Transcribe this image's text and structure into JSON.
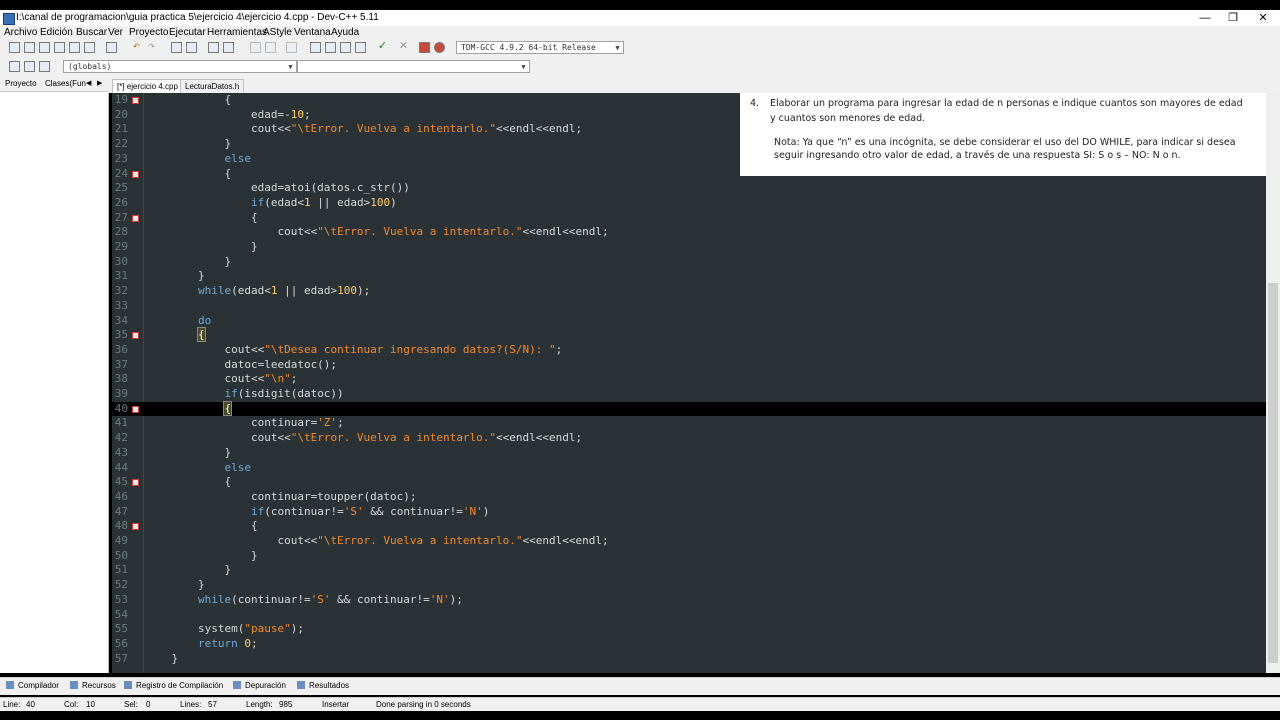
{
  "window": {
    "title": "I:\\canal de programacion\\guia practica 5\\ejercicio 4\\ejercicio 4.cpp - Dev-C++ 5.11"
  },
  "menu": [
    "Archivo",
    "Edición",
    "Buscar",
    "Ver",
    "Proyecto",
    "Ejecutar",
    "Herramientas",
    "AStyle",
    "Ventana",
    "Ayuda"
  ],
  "toolbar": {
    "compiler": "TDM-GCC 4.9.2 64-bit Release",
    "scope": "(globals)",
    "symbol": ""
  },
  "left_panel": {
    "tabs": [
      "Proyecto",
      "Clases(Fun"
    ]
  },
  "editor_tabs": [
    "[*] ejercicio 4.cpp",
    "LecturaDatos.h"
  ],
  "code_lines": [
    {
      "n": "19",
      "fold": true,
      "seg": [
        [
          "p",
          "            {"
        ]
      ]
    },
    {
      "n": "20",
      "seg": [
        [
          "p",
          "                edad=-"
        ],
        [
          "num",
          "10"
        ],
        [
          "p",
          ";"
        ]
      ]
    },
    {
      "n": "21",
      "seg": [
        [
          "p",
          "                cout<<"
        ],
        [
          "str",
          "\"\\tError. Vuelva a intentarlo.\""
        ],
        [
          "p",
          "<<endl<<endl;"
        ]
      ]
    },
    {
      "n": "22",
      "seg": [
        [
          "p",
          "            }"
        ]
      ]
    },
    {
      "n": "23",
      "seg": [
        [
          "kw",
          "            else"
        ]
      ]
    },
    {
      "n": "24",
      "fold": true,
      "seg": [
        [
          "p",
          "            {"
        ]
      ]
    },
    {
      "n": "25",
      "seg": [
        [
          "p",
          "                edad=atoi(datos.c_str())"
        ]
      ]
    },
    {
      "n": "26",
      "seg": [
        [
          "kw",
          "                if"
        ],
        [
          "p",
          "(edad<"
        ],
        [
          "num",
          "1"
        ],
        [
          "p",
          " || edad>"
        ],
        [
          "num",
          "100"
        ],
        [
          "p",
          ")"
        ]
      ]
    },
    {
      "n": "27",
      "fold": true,
      "seg": [
        [
          "p",
          "                {"
        ]
      ]
    },
    {
      "n": "28",
      "seg": [
        [
          "p",
          "                    cout<<"
        ],
        [
          "str",
          "\"\\tError. Vuelva a intentarlo.\""
        ],
        [
          "p",
          "<<endl<<endl;"
        ]
      ]
    },
    {
      "n": "29",
      "seg": [
        [
          "p",
          "                }"
        ]
      ]
    },
    {
      "n": "30",
      "seg": [
        [
          "p",
          "            }"
        ]
      ]
    },
    {
      "n": "31",
      "seg": [
        [
          "p",
          "        }"
        ]
      ]
    },
    {
      "n": "32",
      "seg": [
        [
          "kw",
          "        while"
        ],
        [
          "p",
          "(edad<"
        ],
        [
          "num",
          "1"
        ],
        [
          "p",
          " || edad>"
        ],
        [
          "num",
          "100"
        ],
        [
          "p",
          ");"
        ]
      ]
    },
    {
      "n": "33",
      "seg": [
        [
          "p",
          ""
        ]
      ]
    },
    {
      "n": "34",
      "seg": [
        [
          "kw",
          "        do"
        ]
      ]
    },
    {
      "n": "35",
      "fold": true,
      "seg": [
        [
          "p",
          "        "
        ],
        [
          "brk",
          "{"
        ]
      ]
    },
    {
      "n": "36",
      "seg": [
        [
          "p",
          "            cout<<"
        ],
        [
          "str",
          "\"\\tDesea continuar ingresando datos?(S/N): \""
        ],
        [
          "p",
          ";"
        ]
      ]
    },
    {
      "n": "37",
      "seg": [
        [
          "p",
          "            datoc=leedatoc();"
        ]
      ]
    },
    {
      "n": "38",
      "seg": [
        [
          "p",
          "            cout<<"
        ],
        [
          "str",
          "\"\\n\""
        ],
        [
          "p",
          ";"
        ]
      ]
    },
    {
      "n": "39",
      "seg": [
        [
          "kw",
          "            if"
        ],
        [
          "p",
          "(isdigit(datoc))"
        ]
      ]
    },
    {
      "n": "40",
      "fold": true,
      "hl": true,
      "seg": [
        [
          "p",
          "            "
        ],
        [
          "brk",
          "{"
        ]
      ]
    },
    {
      "n": "41",
      "seg": [
        [
          "p",
          "                continuar="
        ],
        [
          "str",
          "'Z'"
        ],
        [
          "p",
          ";"
        ]
      ]
    },
    {
      "n": "42",
      "seg": [
        [
          "p",
          "                cout<<"
        ],
        [
          "str",
          "\"\\tError. Vuelva a intentarlo.\""
        ],
        [
          "p",
          "<<endl<<endl;"
        ]
      ]
    },
    {
      "n": "43",
      "seg": [
        [
          "p",
          "            }"
        ]
      ]
    },
    {
      "n": "44",
      "seg": [
        [
          "kw",
          "            else"
        ]
      ]
    },
    {
      "n": "45",
      "fold": true,
      "seg": [
        [
          "p",
          "            {"
        ]
      ]
    },
    {
      "n": "46",
      "seg": [
        [
          "p",
          "                continuar=toupper(datoc);"
        ]
      ]
    },
    {
      "n": "47",
      "seg": [
        [
          "kw",
          "                if"
        ],
        [
          "p",
          "(continuar!="
        ],
        [
          "str",
          "'S'"
        ],
        [
          "p",
          " && continuar!="
        ],
        [
          "str",
          "'N'"
        ],
        [
          "p",
          ")"
        ]
      ]
    },
    {
      "n": "48",
      "fold": true,
      "seg": [
        [
          "p",
          "                {"
        ]
      ]
    },
    {
      "n": "49",
      "seg": [
        [
          "p",
          "                    cout<<"
        ],
        [
          "str",
          "\"\\tError. Vuelva a intentarlo.\""
        ],
        [
          "p",
          "<<endl<<endl;"
        ]
      ]
    },
    {
      "n": "50",
      "seg": [
        [
          "p",
          "                }"
        ]
      ]
    },
    {
      "n": "51",
      "seg": [
        [
          "p",
          "            }"
        ]
      ]
    },
    {
      "n": "52",
      "seg": [
        [
          "p",
          "        }"
        ]
      ]
    },
    {
      "n": "53",
      "seg": [
        [
          "kw",
          "        while"
        ],
        [
          "p",
          "(continuar!="
        ],
        [
          "str",
          "'S'"
        ],
        [
          "p",
          " && continuar!="
        ],
        [
          "str",
          "'N'"
        ],
        [
          "p",
          ");"
        ]
      ]
    },
    {
      "n": "54",
      "seg": [
        [
          "p",
          ""
        ]
      ]
    },
    {
      "n": "55",
      "seg": [
        [
          "p",
          "        system("
        ],
        [
          "str",
          "\"pause\""
        ],
        [
          "p",
          ");"
        ]
      ]
    },
    {
      "n": "56",
      "seg": [
        [
          "kw",
          "        return "
        ],
        [
          "num",
          "0"
        ],
        [
          "p",
          ";"
        ]
      ]
    },
    {
      "n": "57",
      "seg": [
        [
          "p",
          "    }"
        ]
      ]
    }
  ],
  "assignment": {
    "number": "4.",
    "line1": "Elaborar un programa para ingresar la edad de n personas e indique cuantos son mayores de edad",
    "line2": "y cuantos son menores de edad.",
    "note1": "Nota: Ya que “n” es una incógnita, se debe considerar el uso del DO WHILE, para indicar si desea",
    "note2": "seguir ingresando otro valor de edad, a través de una respuesta SI: S o s – NO: N o n."
  },
  "bottom_tabs": [
    "Compilador",
    "Recursos",
    "Registro de Compilación",
    "Depuración",
    "Resultados"
  ],
  "status": {
    "line_label": "Line:",
    "line": "40",
    "col_label": "Col:",
    "col": "10",
    "sel_label": "Sel:",
    "sel": "0",
    "lines_label": "Lines:",
    "lines": "57",
    "length_label": "Length:",
    "length": "985",
    "mode": "Insertar",
    "message": "Done parsing in 0 seconds"
  },
  "colors": {
    "editor_bg": "#2b3236",
    "keyword": "#6fa9d6",
    "string": "#ef8a2e",
    "number": "#ffce6a",
    "fold_mark": "#cc3a3a"
  }
}
